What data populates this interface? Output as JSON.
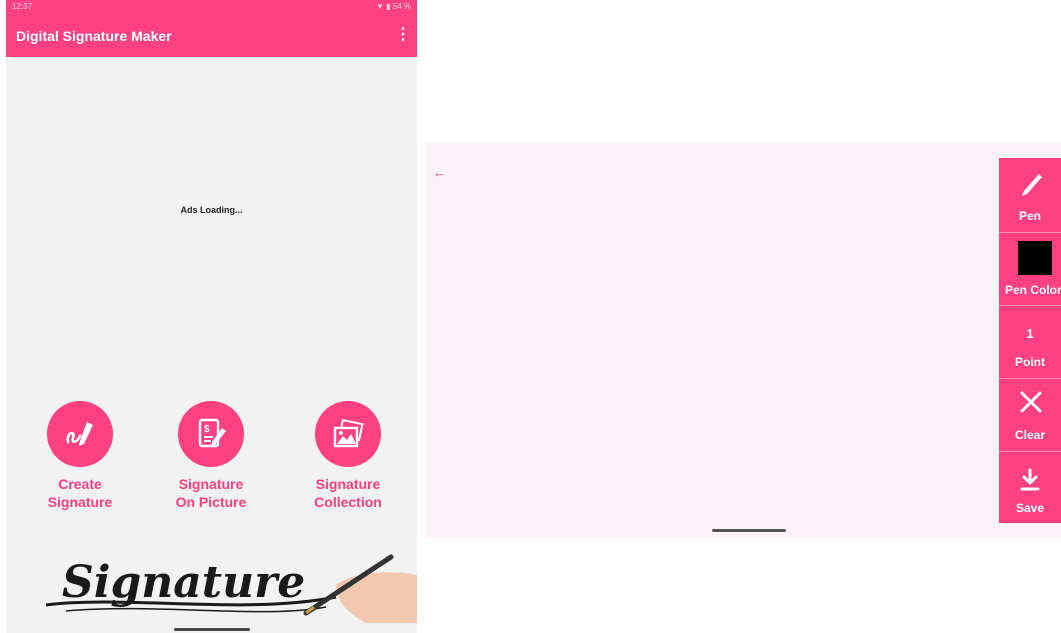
{
  "left_screen": {
    "status_bar": {
      "time": "12:37",
      "indicators": "▼ ▮ 54 %"
    },
    "app_bar": {
      "title": "Digital Signature Maker",
      "menu_icon": "more-vert-icon"
    },
    "ads_text": "Ads Loading...",
    "features": [
      {
        "line1": "Create",
        "line2": "Signature",
        "icon": "signature-pen-icon"
      },
      {
        "line1": "Signature",
        "line2": "On Picture",
        "icon": "document-edit-icon"
      },
      {
        "line1": "Signature",
        "line2": "Collection",
        "icon": "image-gallery-icon"
      }
    ],
    "banner_text": "Signature"
  },
  "right_screen": {
    "back_icon": "arrow-left-icon",
    "tools": {
      "pen": {
        "label": "Pen",
        "icon": "pen-icon"
      },
      "pen_color": {
        "label": "Pen Color",
        "value": "#000000"
      },
      "point": {
        "label": "Point",
        "value": "1"
      },
      "clear": {
        "label": "Clear",
        "icon": "close-icon"
      },
      "save": {
        "label": "Save",
        "icon": "download-icon"
      }
    }
  },
  "colors": {
    "accent": "#ff4081",
    "canvas": "#fdf2f8",
    "background": "#f2f2f2"
  }
}
